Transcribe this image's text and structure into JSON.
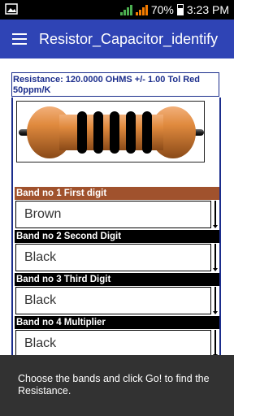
{
  "status_bar": {
    "battery_percent": "70%",
    "time": "3:23 PM",
    "icons": [
      "image-notification-icon",
      "signal-icon",
      "battery-icon"
    ]
  },
  "app_bar": {
    "title": "Resistor_Capacitor_identify",
    "menu_icon": "hamburger-menu-icon"
  },
  "result": {
    "text": "Resistance: 120.0000 OHMS +/- 1.00 Tol Red 50ppm/K"
  },
  "resistor_image": {
    "body_color": "#d9823b",
    "bands": [
      {
        "color": "Brown",
        "hex": "#000000"
      },
      {
        "color": "Black",
        "hex": "#000000"
      },
      {
        "color": "Black",
        "hex": "#000000"
      },
      {
        "color": "Black",
        "hex": "#000000"
      },
      {
        "color": "Red",
        "hex": "#000000"
      }
    ]
  },
  "bands": [
    {
      "label": "Band no 1 First digit",
      "value": "Brown",
      "label_color": "#a0522d"
    },
    {
      "label": "Band no 2 Second Digit",
      "value": "Black",
      "label_color": "#000000"
    },
    {
      "label": "Band no 3 Third Digit",
      "value": "Black",
      "label_color": "#000000"
    },
    {
      "label": "Band no 4 Multiplier",
      "value": "Black",
      "label_color": "#000000"
    }
  ],
  "toast": {
    "message": "Choose the bands and click Go! to find the Resistance."
  },
  "colors": {
    "app_bar": "#2f44b5",
    "result_text": "#1b2d8c"
  }
}
